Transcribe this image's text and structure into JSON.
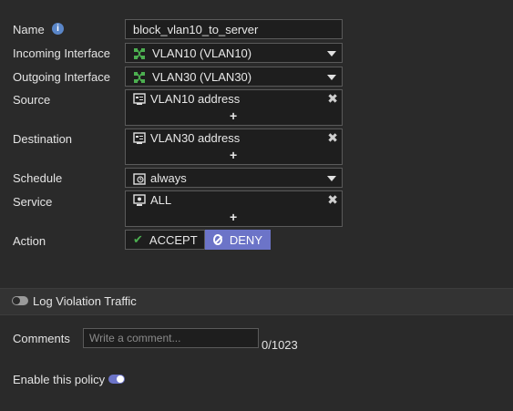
{
  "colors": {
    "background": "#2a2a2a",
    "field_bg": "#1e1e1e",
    "accent": "#6c74c8",
    "accept_check": "#4caf50",
    "info_icon": "#5a86c8",
    "interface_icon": "#4caf50"
  },
  "form": {
    "name": {
      "label": "Name",
      "value": "block_vlan10_to_server"
    },
    "incoming": {
      "label": "Incoming Interface",
      "value": "VLAN10 (VLAN10)",
      "icon": "network-interface-icon"
    },
    "outgoing": {
      "label": "Outgoing Interface",
      "value": "VLAN30 (VLAN30)",
      "icon": "network-interface-icon"
    },
    "source": {
      "label": "Source",
      "value": "VLAN10 address",
      "icon": "address-object-icon",
      "add": "+",
      "remove": "✖"
    },
    "destination": {
      "label": "Destination",
      "value": "VLAN30 address",
      "icon": "address-object-icon",
      "add": "+",
      "remove": "✖"
    },
    "schedule": {
      "label": "Schedule",
      "value": "always",
      "icon": "schedule-icon"
    },
    "service": {
      "label": "Service",
      "value": "ALL",
      "icon": "service-icon",
      "add": "+",
      "remove": "✖"
    },
    "action": {
      "label": "Action",
      "accept": "ACCEPT",
      "deny": "DENY",
      "selected": "DENY"
    }
  },
  "log_violation": {
    "label": "Log Violation Traffic",
    "enabled": false
  },
  "comments": {
    "label": "Comments",
    "placeholder": "Write a comment...",
    "counter": "0/1023"
  },
  "enable_policy": {
    "label": "Enable this policy",
    "enabled": true
  }
}
